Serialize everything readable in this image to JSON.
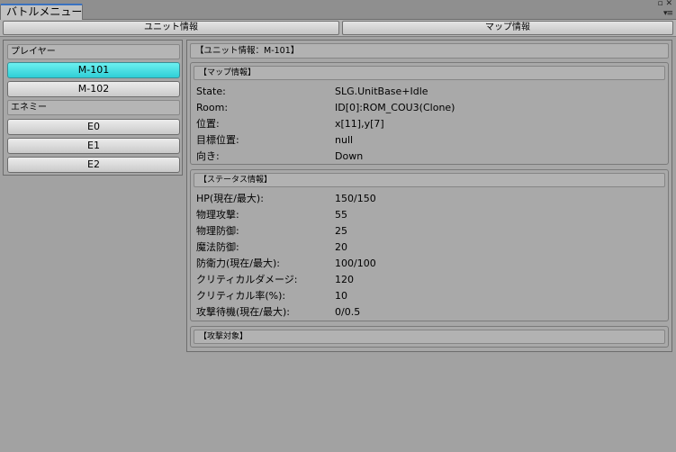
{
  "window": {
    "tab_title": "バトルメニュー",
    "controls": {
      "maximize_glyph": "▫",
      "close_glyph": "✕",
      "menu_glyph": "▾≡"
    }
  },
  "toolbar": {
    "unit_info_label": "ユニット情報",
    "map_info_label": "マップ情報"
  },
  "left": {
    "player_header": "プレイヤー",
    "players": [
      {
        "label": "M-101",
        "selected": true
      },
      {
        "label": "M-102",
        "selected": false
      }
    ],
    "enemy_header": "エネミー",
    "enemies": [
      {
        "label": "E0"
      },
      {
        "label": "E1"
      },
      {
        "label": "E2"
      }
    ]
  },
  "right": {
    "unit_header": "【ユニット情報：M-101】",
    "map_section": {
      "title": "【マップ情報】",
      "rows": [
        {
          "key": "State:",
          "value": "SLG.UnitBase+Idle"
        },
        {
          "key": "Room:",
          "value": "ID[0]:ROM_COU3(Clone)"
        },
        {
          "key": "位置:",
          "value": "x[11],y[7]"
        },
        {
          "key": "目標位置:",
          "value": "null"
        },
        {
          "key": "向き:",
          "value": "Down"
        }
      ]
    },
    "status_section": {
      "title": "【ステータス情報】",
      "rows": [
        {
          "key": "HP(現在/最大):",
          "value": "150/150"
        },
        {
          "key": "物理攻撃:",
          "value": "55"
        },
        {
          "key": "物理防御:",
          "value": "25"
        },
        {
          "key": "魔法防御:",
          "value": "20"
        },
        {
          "key": "防衛力(現在/最大):",
          "value": "100/100"
        },
        {
          "key": "クリティカルダメージ:",
          "value": "120"
        },
        {
          "key": "クリティカル率(%):",
          "value": "10"
        },
        {
          "key": "攻撃待機(現在/最大):",
          "value": "0/0.5"
        }
      ]
    },
    "attack_target_section": {
      "title": "【攻撃対象】"
    }
  },
  "colors": {
    "selected_button": "#2fcfd6",
    "background": "#a2a2a2",
    "tab_accent": "#3a72c0"
  }
}
